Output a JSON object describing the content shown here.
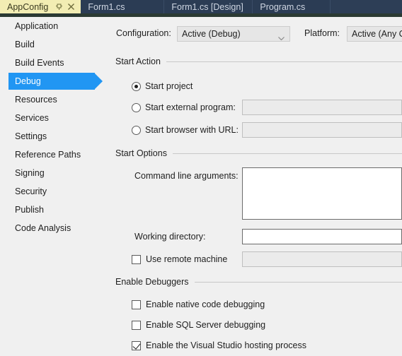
{
  "tabs": {
    "active": {
      "label": "AppConfig",
      "pin_icon": "pin-icon",
      "close_icon": "close-icon"
    },
    "items": [
      {
        "label": "Form1.cs"
      },
      {
        "label": "Form1.cs [Design]"
      },
      {
        "label": "Program.cs"
      }
    ]
  },
  "sidebar": {
    "items": [
      {
        "label": "Application",
        "selected": false
      },
      {
        "label": "Build",
        "selected": false
      },
      {
        "label": "Build Events",
        "selected": false
      },
      {
        "label": "Debug",
        "selected": true
      },
      {
        "label": "Resources",
        "selected": false
      },
      {
        "label": "Services",
        "selected": false
      },
      {
        "label": "Settings",
        "selected": false
      },
      {
        "label": "Reference Paths",
        "selected": false
      },
      {
        "label": "Signing",
        "selected": false
      },
      {
        "label": "Security",
        "selected": false
      },
      {
        "label": "Publish",
        "selected": false
      },
      {
        "label": "Code Analysis",
        "selected": false
      }
    ]
  },
  "top_row": {
    "configuration_label": "Configuration:",
    "configuration_value": "Active (Debug)",
    "platform_label": "Platform:",
    "platform_value": "Active (Any CPU)"
  },
  "start_action": {
    "group_label": "Start Action",
    "options": [
      {
        "label": "Start project",
        "checked": true
      },
      {
        "label": "Start external program:",
        "checked": false
      },
      {
        "label": "Start browser with URL:",
        "checked": false
      }
    ],
    "external_program_value": "",
    "browser_url_value": ""
  },
  "start_options": {
    "group_label": "Start Options",
    "command_line_label": "Command line arguments:",
    "command_line_value": "",
    "working_directory_label": "Working directory:",
    "working_directory_value": "",
    "use_remote_machine_label": "Use remote machine",
    "use_remote_machine_checked": false,
    "remote_machine_value": ""
  },
  "enable_debuggers": {
    "group_label": "Enable Debuggers",
    "options": [
      {
        "label": "Enable native code debugging",
        "checked": false
      },
      {
        "label": "Enable SQL Server debugging",
        "checked": false
      },
      {
        "label": "Enable the Visual Studio hosting process",
        "checked": true
      }
    ]
  },
  "colors": {
    "accent_selected": "#2196f3",
    "active_tab": "#f2edb3",
    "tabbar": "#2d3e56",
    "pane_bg": "#f0f0f0"
  }
}
